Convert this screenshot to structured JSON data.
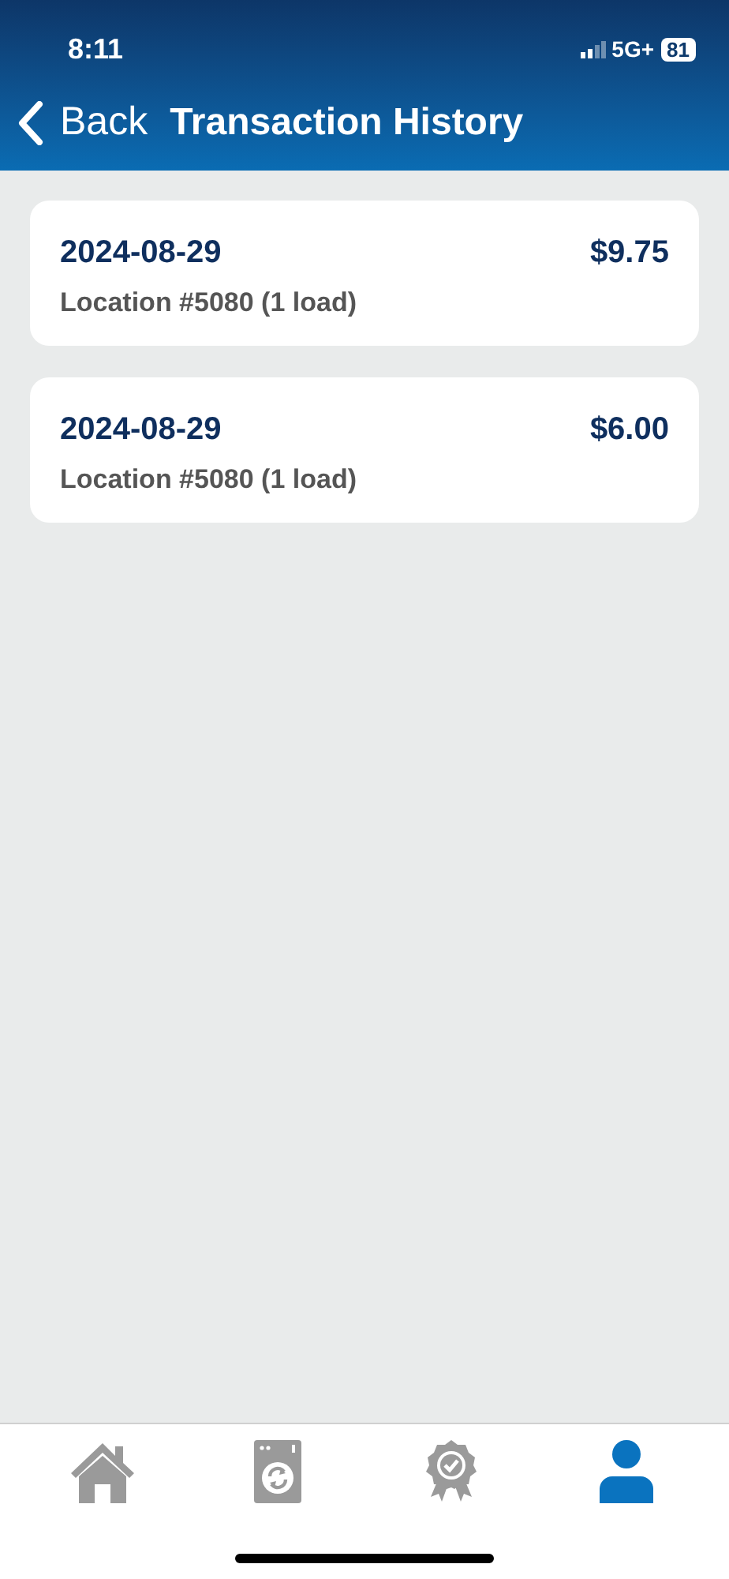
{
  "status_bar": {
    "time": "8:11",
    "network": "5G+",
    "battery": "81"
  },
  "nav": {
    "back": "Back",
    "title": "Transaction History"
  },
  "transactions": [
    {
      "date": "2024-08-29",
      "amount": "$9.75",
      "location": "Location #5080 (1 load)"
    },
    {
      "date": "2024-08-29",
      "amount": "$6.00",
      "location": "Location #5080 (1 load)"
    }
  ],
  "tabs": [
    {
      "kind": "home",
      "selected": false
    },
    {
      "kind": "washer",
      "selected": false
    },
    {
      "kind": "award",
      "selected": false
    },
    {
      "kind": "profile",
      "selected": true
    }
  ]
}
